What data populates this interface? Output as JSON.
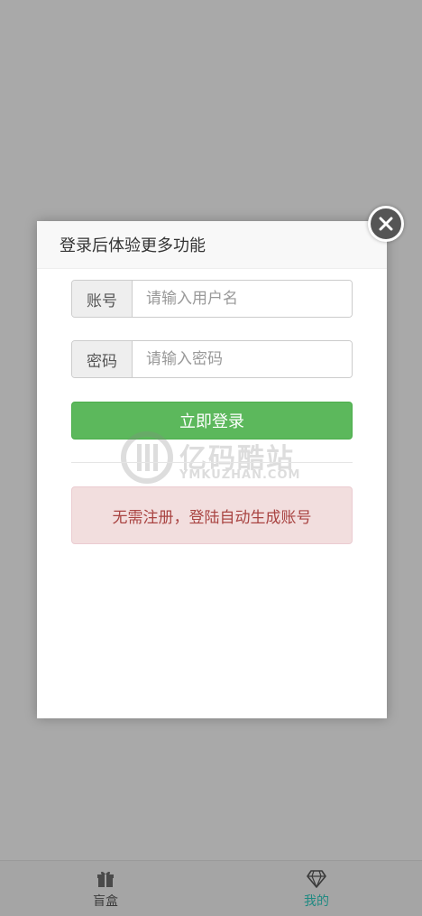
{
  "modal": {
    "title": "登录后体验更多功能",
    "username": {
      "label": "账号",
      "placeholder": "请输入用户名",
      "value": ""
    },
    "password": {
      "label": "密码",
      "placeholder": "请输入密码",
      "value": ""
    },
    "login_button": "立即登录",
    "notice": "无需注册，登陆自动生成账号"
  },
  "watermark": {
    "cn": "亿码酷站",
    "en": "YMKUZHAN.COM"
  },
  "tabbar": {
    "items": [
      {
        "label": "盲盒",
        "icon": "gift-icon",
        "active": false
      },
      {
        "label": "我的",
        "icon": "diamond-icon",
        "active": true
      }
    ]
  },
  "colors": {
    "overlay": "#a9a9a9",
    "success": "#5cb85c",
    "danger_bg": "#f2dede",
    "danger_text": "#a94442",
    "tab_active": "#1f8a82",
    "tab_inactive": "#3a3a3a"
  }
}
